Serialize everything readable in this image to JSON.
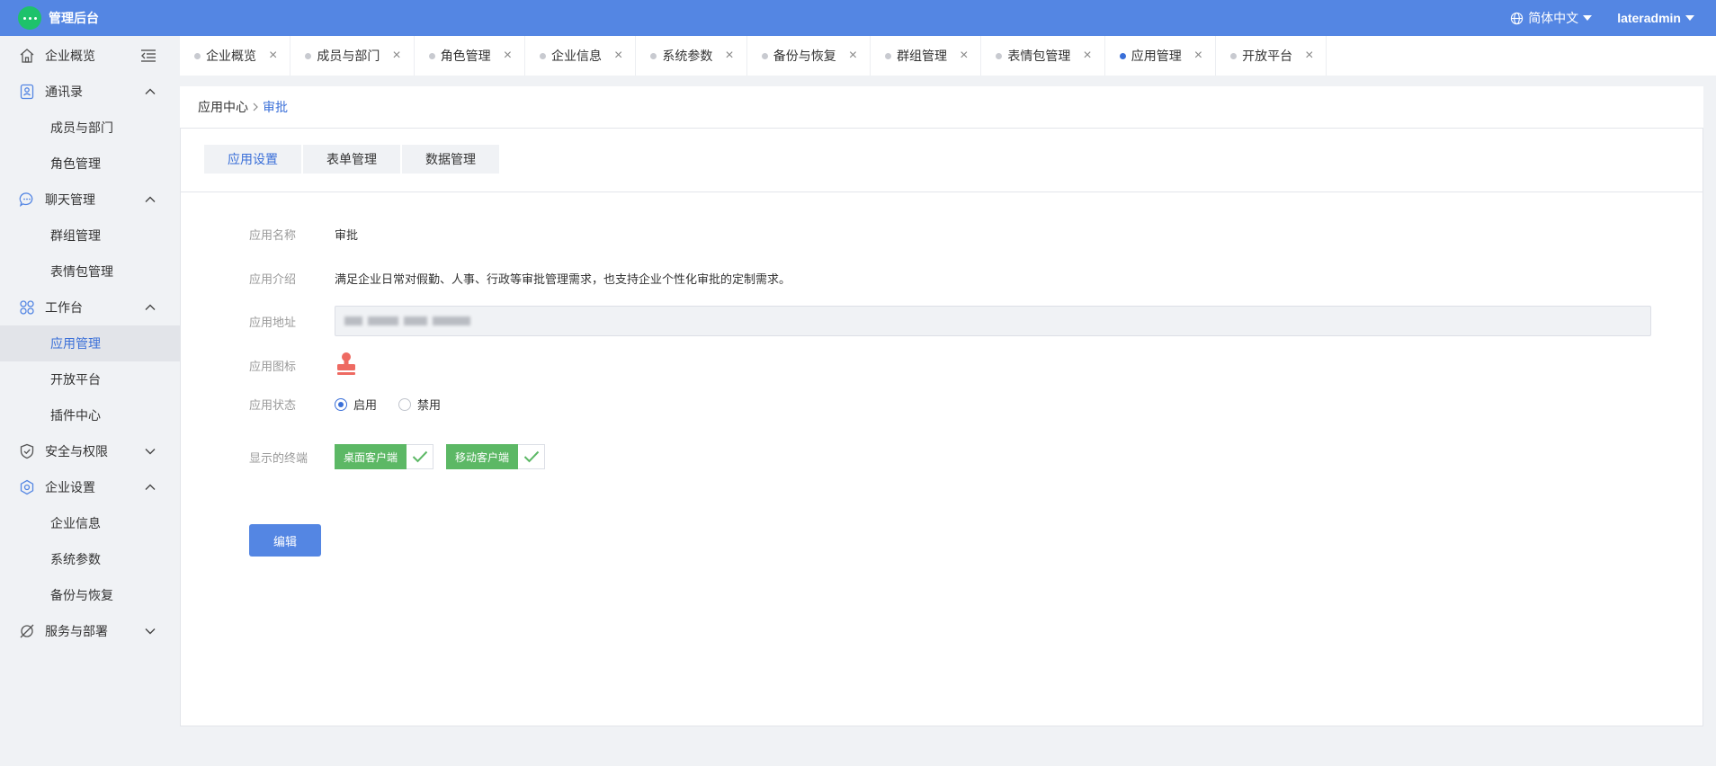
{
  "app": {
    "title": "管理后台",
    "language": "简体中文",
    "user": "lateradmin"
  },
  "sidebar": {
    "items": [
      {
        "label": "企业概览",
        "icon": "home-icon"
      },
      {
        "label": "通讯录",
        "icon": "contacts-icon",
        "children": [
          "成员与部门",
          "角色管理"
        ]
      },
      {
        "label": "聊天管理",
        "icon": "chat-icon",
        "children": [
          "群组管理",
          "表情包管理"
        ]
      },
      {
        "label": "工作台",
        "icon": "workbench-icon",
        "children": [
          "应用管理",
          "开放平台",
          "插件中心"
        ]
      },
      {
        "label": "安全与权限",
        "icon": "shield-icon"
      },
      {
        "label": "企业设置",
        "icon": "settings-icon",
        "children": [
          "企业信息",
          "系统参数",
          "备份与恢复"
        ]
      },
      {
        "label": "服务与部署",
        "icon": "deploy-icon"
      }
    ],
    "active": "应用管理"
  },
  "tabs": [
    "企业概览",
    "成员与部门",
    "角色管理",
    "企业信息",
    "系统参数",
    "备份与恢复",
    "群组管理",
    "表情包管理",
    "应用管理",
    "开放平台"
  ],
  "active_tab": "应用管理",
  "breadcrumb": {
    "parent": "应用中心",
    "current": "审批"
  },
  "subtabs": [
    "应用设置",
    "表单管理",
    "数据管理"
  ],
  "form": {
    "name_label": "应用名称",
    "name_value": "审批",
    "intro_label": "应用介绍",
    "intro_value": "满足企业日常对假勤、人事、行政等审批管理需求，也支持企业个性化审批的定制需求。",
    "address_label": "应用地址",
    "icon_label": "应用图标",
    "status_label": "应用状态",
    "status_options": [
      "启用",
      "禁用"
    ],
    "status_selected": "启用",
    "terminals_label": "显示的终端",
    "terminals": [
      "桌面客户端",
      "移动客户端"
    ],
    "edit_button": "编辑"
  },
  "colors": {
    "primary": "#5486e3",
    "accent_text": "#3a6fd8",
    "success": "#5cb865",
    "logo": "#1ec26b",
    "stamp_icon": "#ee6a62"
  }
}
